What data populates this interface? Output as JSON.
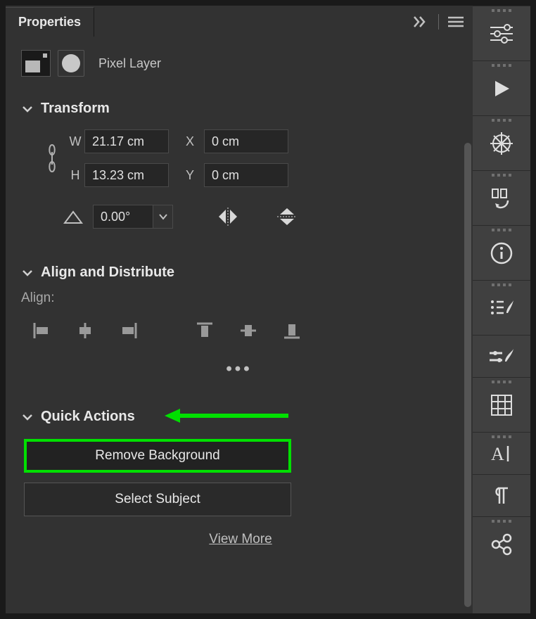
{
  "panel": {
    "title": "Properties"
  },
  "layer": {
    "type_label": "Pixel Layer"
  },
  "transform": {
    "title": "Transform",
    "w_label": "W",
    "w_value": "21.17 cm",
    "h_label": "H",
    "h_value": "13.23 cm",
    "x_label": "X",
    "x_value": "0 cm",
    "y_label": "Y",
    "y_value": "0 cm",
    "rotation": "0.00°"
  },
  "align": {
    "title": "Align and Distribute",
    "label": "Align:"
  },
  "quick_actions": {
    "title": "Quick Actions",
    "remove_bg": "Remove Background",
    "select_subject": "Select Subject",
    "view_more": "View More"
  },
  "annotation": {
    "highlight_color": "#00e000"
  }
}
